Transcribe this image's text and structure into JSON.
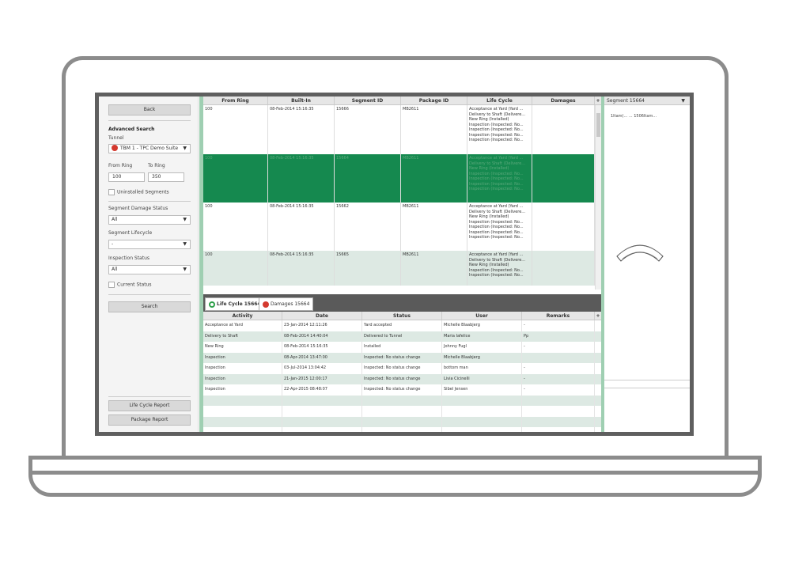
{
  "left": {
    "back_label": "Back",
    "advanced_search": "Advanced Search",
    "tunnel_label": "Tunnel",
    "tunnel_value": "TBM 1 - TPC Demo Suite",
    "from_ring_label": "From Ring",
    "to_ring_label": "To Ring",
    "from_ring_value": "100",
    "to_ring_value": "350",
    "uninstalled_label": "Uninstalled Segments",
    "damage_status_label": "Segment Damage Status",
    "damage_status_value": "All",
    "lifecycle_label": "Segment Lifecycle",
    "lifecycle_value": "-",
    "inspection_label": "Inspection Status",
    "inspection_value": "All",
    "current_status_label": "Current Status",
    "search_label": "Search",
    "lifecycle_report_label": "Life Cycle Report",
    "package_report_label": "Package Report"
  },
  "grid": {
    "columns": [
      "From Ring",
      "Built-In",
      "Segment ID",
      "Package ID",
      "Life Cycle",
      "Damages"
    ],
    "rows": [
      {
        "from_ring": "100",
        "built_in": "08-Feb-2014 15:16:35",
        "segment_id": "15666",
        "package_id": "MB2611",
        "life_cycle": [
          "Acceptance at Yard (Yard ...",
          "Delivery to Shaft (Delivere...",
          "New Ring (Installed)",
          "Inspection (Inspected: No...",
          "Inspection (Inspected: No...",
          "Inspection (Inspected: No...",
          "Inspection (Inspected: No..."
        ],
        "damages": ""
      },
      {
        "from_ring": "100",
        "built_in": "08-Feb-2014 15:16:35",
        "segment_id": "15664",
        "package_id": "MB2611",
        "life_cycle": [
          "Acceptance at Yard (Yard ...",
          "Delivery to Shaft (Delivere...",
          "New Ring (Installed)",
          "Inspection (Inspected: No...",
          "Inspection (Inspected: No...",
          "Inspection (Inspected: No...",
          "Inspection (Inspected: No..."
        ],
        "damages": ""
      },
      {
        "from_ring": "100",
        "built_in": "08-Feb-2014 15:16:35",
        "segment_id": "15662",
        "package_id": "MB2611",
        "life_cycle": [
          "Acceptance at Yard (Yard ...",
          "Delivery to Shaft (Delivere...",
          "New Ring (Installed)",
          "Inspection (Inspected: No...",
          "Inspection (Inspected: No...",
          "Inspection (Inspected: No...",
          "Inspection (Inspected: No..."
        ],
        "damages": ""
      },
      {
        "from_ring": "100",
        "built_in": "08-Feb-2014 15:16:35",
        "segment_id": "15665",
        "package_id": "MB2611",
        "life_cycle": [
          "Acceptance at Yard (Yard ...",
          "Delivery to Shaft (Delivere...",
          "New Ring (Installed)",
          "Inspection (Inspected: No...",
          "Inspection (Inspected: No..."
        ],
        "damages": ""
      }
    ]
  },
  "tabs": {
    "lifecycle": "Life Cycle 15664",
    "damages": "Damages 15664"
  },
  "lifecycle_table": {
    "columns": [
      "Activity",
      "Date",
      "Status",
      "User",
      "Remarks"
    ],
    "rows": [
      [
        "Acceptance at Yard",
        "23-Jan-2014 12:11:26",
        "Yard accepted",
        "Michelle Blaabjerg",
        "-"
      ],
      [
        "Delivery to Shaft",
        "08-Feb-2014 14:40:04",
        "Delivered to Tunnel",
        "Maria Iafelice",
        "Pp"
      ],
      [
        "New Ring",
        "08-Feb-2014 15:16:35",
        "Installed",
        "Johnny Fugl",
        "-"
      ],
      [
        "Inspection",
        "08-Apr-2014 13:47:00",
        "Inspected: No status change",
        "Michelle Blaabjerg",
        ""
      ],
      [
        "Inspection",
        "03-Jul-2014 13:04:42",
        "Inspected: No status change",
        "bottom man",
        "-"
      ],
      [
        "Inspection",
        "21-Jan-2015 12:00:17",
        "Inspected: No status change",
        "Livia Cicinelli",
        "-"
      ],
      [
        "Inspection",
        "22-Apr-2015 08:48:07",
        "Inspected: No status change",
        "Sibel Jensen",
        "-"
      ]
    ]
  },
  "right": {
    "title": "Segment 15664",
    "info": "1Itam(... ... 1506Itam..."
  }
}
